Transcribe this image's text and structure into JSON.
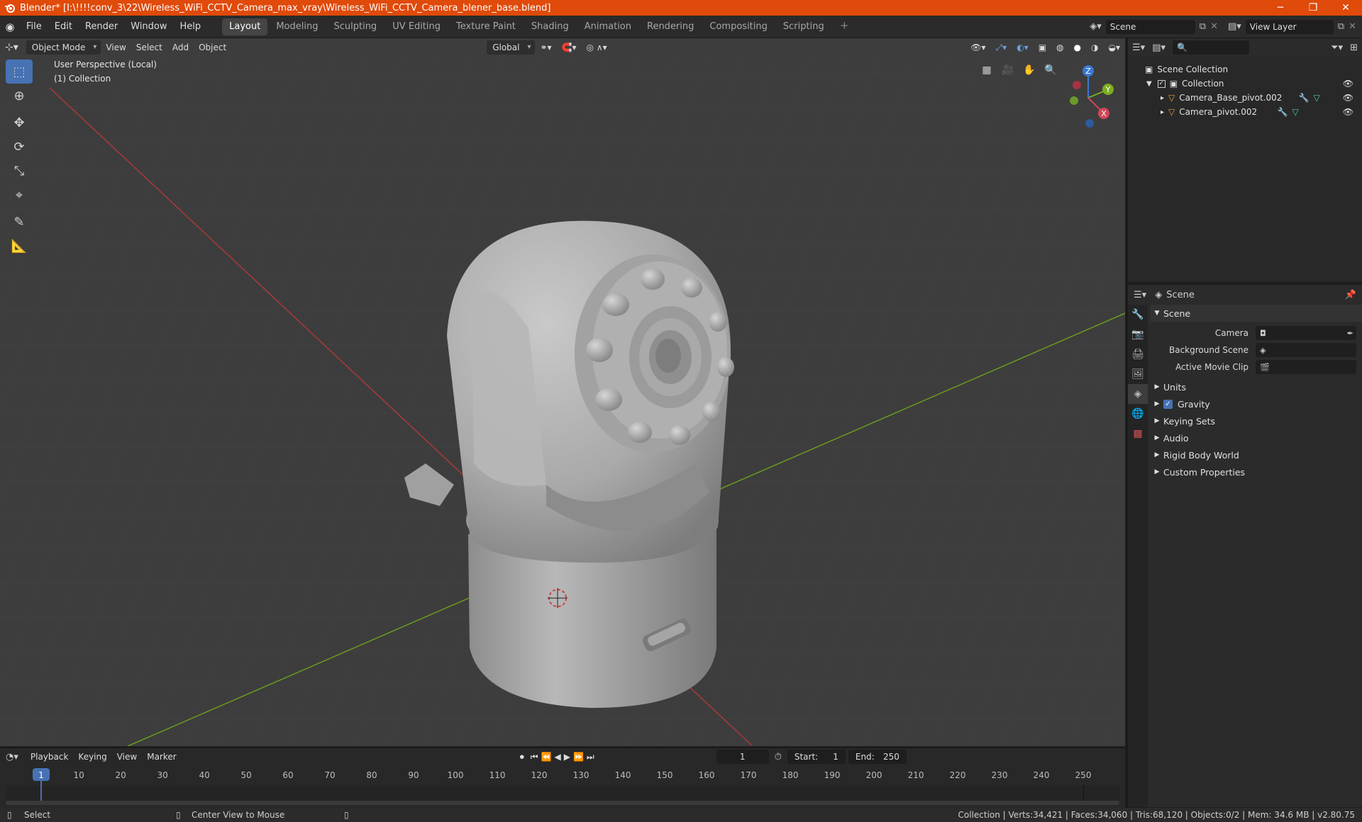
{
  "window": {
    "title": "Blender* [I:\\!!!!conv_3\\22\\Wireless_WiFi_CCTV_Camera_max_vray\\Wireless_WiFi_CCTV_Camera_blener_base.blend]"
  },
  "menu": [
    "File",
    "Edit",
    "Render",
    "Window",
    "Help"
  ],
  "workspaces": [
    "Layout",
    "Modeling",
    "Sculpting",
    "UV Editing",
    "Texture Paint",
    "Shading",
    "Animation",
    "Rendering",
    "Compositing",
    "Scripting"
  ],
  "active_workspace": "Layout",
  "scene_field": "Scene",
  "view_layer_field": "View Layer",
  "viewport": {
    "mode": "Object Mode",
    "menus": [
      "View",
      "Select",
      "Add",
      "Object"
    ],
    "transform_orientation": "Global",
    "overlay_line1": "User Perspective (Local)",
    "overlay_line2": "(1) Collection",
    "gizmo": {
      "z": "Z",
      "y": "Y",
      "x": "X"
    }
  },
  "outliner": {
    "root": "Scene Collection",
    "collection": "Collection",
    "objects": [
      "Camera_Base_pivot.002",
      "Camera_pivot.002"
    ]
  },
  "properties": {
    "context": "Scene",
    "panel_title": "Scene",
    "fields": [
      {
        "label": "Camera"
      },
      {
        "label": "Background Scene"
      },
      {
        "label": "Active Movie Clip"
      }
    ],
    "subpanels": [
      "Units",
      "Gravity",
      "Keying Sets",
      "Audio",
      "Rigid Body World",
      "Custom Properties"
    ],
    "gravity_checked": true
  },
  "timeline": {
    "menus": [
      "Playback",
      "Keying",
      "View",
      "Marker"
    ],
    "current_frame": "1",
    "start_label": "Start:",
    "start_value": "1",
    "end_label": "End:",
    "end_value": "250",
    "ticks": [
      "1",
      "10",
      "20",
      "30",
      "40",
      "50",
      "60",
      "70",
      "80",
      "90",
      "100",
      "110",
      "120",
      "130",
      "140",
      "150",
      "160",
      "170",
      "180",
      "190",
      "200",
      "210",
      "220",
      "230",
      "240",
      "250"
    ]
  },
  "status": {
    "left_action": "Select",
    "middle_action": "Center View to Mouse",
    "stats": "Collection | Verts:34,421 | Faces:34,060 | Tris:68,120 | Objects:0/2 | Mem: 34.6 MB | v2.80.75"
  },
  "colors": {
    "titlebar": "#e04a0a",
    "accent": "#4772b3",
    "x_axis": "#a83a3a",
    "y_axis": "#6c9a1f",
    "viewport_bg": "#3d3d3d"
  }
}
